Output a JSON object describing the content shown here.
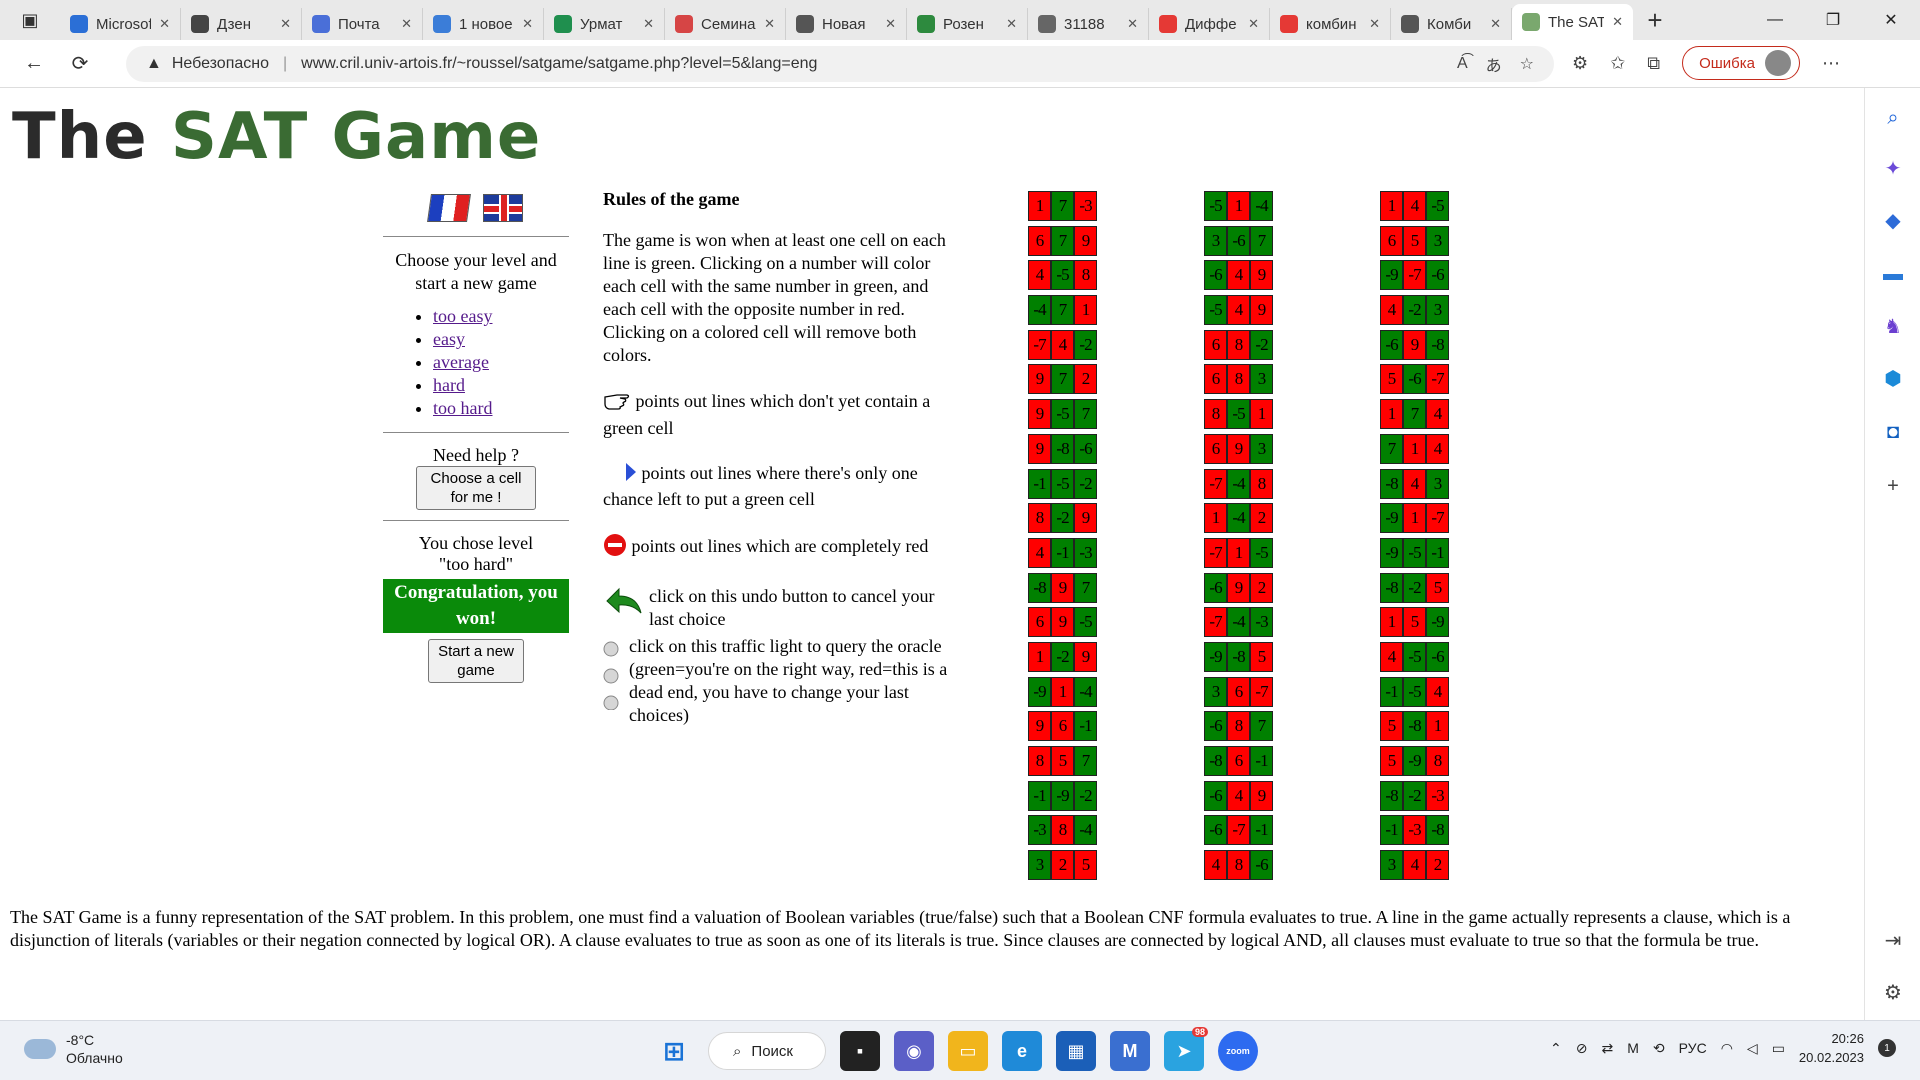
{
  "browser": {
    "tabs": [
      {
        "title": "Microsoft",
        "color": "#2b6fd6"
      },
      {
        "title": "Дзен",
        "color": "#444444"
      },
      {
        "title": "Почта",
        "color": "#4a6fd8"
      },
      {
        "title": "1 новое",
        "color": "#3b7dd8"
      },
      {
        "title": "Урмат",
        "color": "#1f8f4e"
      },
      {
        "title": "Семинар",
        "color": "#d64545"
      },
      {
        "title": "Новая",
        "color": "#555555"
      },
      {
        "title": "Розен",
        "color": "#2d8a3e"
      },
      {
        "title": "31188",
        "color": "#666666"
      },
      {
        "title": "Диффе",
        "color": "#e53935"
      },
      {
        "title": "комбин",
        "color": "#e53935"
      },
      {
        "title": "Комби",
        "color": "#555555"
      },
      {
        "title": "The SAT",
        "color": "#7aa86e",
        "active": true
      }
    ],
    "security_label": "Небезопасно",
    "url": "www.cril.univ-artois.fr/~roussel/satgame/satgame.php?level=5&lang=eng",
    "error_label": "Ошибка"
  },
  "page": {
    "logo_word1": "The",
    "logo_word2": "SAT",
    "logo_word3": "Game",
    "choose_level": "Choose your level and start a new game",
    "levels": [
      "too easy",
      "easy",
      "average",
      "hard",
      "too hard"
    ],
    "need_help": "Need help ?",
    "choose_cell_button": "Choose a cell for me !",
    "you_chose": "You chose level",
    "chosen_level": "\"too hard\"",
    "congrats": "Congratulation, you won!",
    "new_game_button": "Start a new game",
    "rules_title": "Rules of the game",
    "rules_text": "The game is won when at least one cell on each line is green. Clicking on a number will color each cell with the same number in green, and each cell with the opposite number in red. Clicking on a colored cell will remove both colors.",
    "rule_hand": "points out lines which don't yet contain a green cell",
    "rule_arrow": "points out lines where there's only one chance left to put a green cell",
    "rule_stop": "points out lines which are completely red",
    "rule_undo": "click on this undo button to cancel your last choice",
    "rule_oracle": "click on this traffic light to query the oracle (green=you're on the right way, red=this is a dead end, you have to change your last choices)",
    "about": "The SAT Game is a funny representation of the SAT problem. In this problem, one must find a valuation of Boolean variables (true/false) such that a Boolean CNF formula evaluates to true. A line in the game actually represents a clause, which is a disjunction of literals (variables or their negation connected by logical OR). A clause evaluates to true as soon as one of its literals is true. Since clauses are connected by logical AND, all clauses must evaluate to true so that the formula be true."
  },
  "clauses": [
    [
      [
        [
          "1",
          "r"
        ],
        [
          "7",
          "g"
        ],
        [
          "-3",
          "r"
        ]
      ],
      [
        [
          "6",
          "r"
        ],
        [
          "7",
          "g"
        ],
        [
          "9",
          "r"
        ]
      ],
      [
        [
          "4",
          "r"
        ],
        [
          "-5",
          "g"
        ],
        [
          "8",
          "r"
        ]
      ],
      [
        [
          "-4",
          "g"
        ],
        [
          "7",
          "g"
        ],
        [
          "1",
          "r"
        ]
      ],
      [
        [
          "-7",
          "r"
        ],
        [
          "4",
          "r"
        ],
        [
          "-2",
          "g"
        ]
      ],
      [
        [
          "9",
          "r"
        ],
        [
          "7",
          "g"
        ],
        [
          "2",
          "r"
        ]
      ],
      [
        [
          "9",
          "r"
        ],
        [
          "-5",
          "g"
        ],
        [
          "7",
          "g"
        ]
      ],
      [
        [
          "9",
          "r"
        ],
        [
          "-8",
          "g"
        ],
        [
          "-6",
          "g"
        ]
      ],
      [
        [
          "-1",
          "g"
        ],
        [
          "-5",
          "g"
        ],
        [
          "-2",
          "g"
        ]
      ],
      [
        [
          "8",
          "r"
        ],
        [
          "-2",
          "g"
        ],
        [
          "9",
          "r"
        ]
      ],
      [
        [
          "4",
          "r"
        ],
        [
          "-1",
          "g"
        ],
        [
          "-3",
          "g"
        ]
      ],
      [
        [
          "-8",
          "g"
        ],
        [
          "9",
          "r"
        ],
        [
          "7",
          "g"
        ]
      ],
      [
        [
          "6",
          "r"
        ],
        [
          "9",
          "r"
        ],
        [
          "-5",
          "g"
        ]
      ],
      [
        [
          "1",
          "r"
        ],
        [
          "-2",
          "g"
        ],
        [
          "9",
          "r"
        ]
      ],
      [
        [
          "-9",
          "g"
        ],
        [
          "1",
          "r"
        ],
        [
          "-4",
          "g"
        ]
      ],
      [
        [
          "9",
          "r"
        ],
        [
          "6",
          "r"
        ],
        [
          "-1",
          "g"
        ]
      ],
      [
        [
          "8",
          "r"
        ],
        [
          "5",
          "r"
        ],
        [
          "7",
          "g"
        ]
      ],
      [
        [
          "-1",
          "g"
        ],
        [
          "-9",
          "g"
        ],
        [
          "-2",
          "g"
        ]
      ],
      [
        [
          "-3",
          "g"
        ],
        [
          "8",
          "r"
        ],
        [
          "-4",
          "g"
        ]
      ],
      [
        [
          "3",
          "g"
        ],
        [
          "2",
          "r"
        ],
        [
          "5",
          "r"
        ]
      ]
    ],
    [
      [
        [
          "-5",
          "g"
        ],
        [
          "1",
          "r"
        ],
        [
          "-4",
          "g"
        ]
      ],
      [
        [
          "3",
          "g"
        ],
        [
          "-6",
          "g"
        ],
        [
          "7",
          "g"
        ]
      ],
      [
        [
          "-6",
          "g"
        ],
        [
          "4",
          "r"
        ],
        [
          "9",
          "r"
        ]
      ],
      [
        [
          "-5",
          "g"
        ],
        [
          "4",
          "r"
        ],
        [
          "9",
          "r"
        ]
      ],
      [
        [
          "6",
          "r"
        ],
        [
          "8",
          "r"
        ],
        [
          "-2",
          "g"
        ]
      ],
      [
        [
          "6",
          "r"
        ],
        [
          "8",
          "r"
        ],
        [
          "3",
          "g"
        ]
      ],
      [
        [
          "8",
          "r"
        ],
        [
          "-5",
          "g"
        ],
        [
          "1",
          "r"
        ]
      ],
      [
        [
          "6",
          "r"
        ],
        [
          "9",
          "r"
        ],
        [
          "3",
          "g"
        ]
      ],
      [
        [
          "-7",
          "r"
        ],
        [
          "-4",
          "g"
        ],
        [
          "8",
          "r"
        ]
      ],
      [
        [
          "1",
          "r"
        ],
        [
          "-4",
          "g"
        ],
        [
          "2",
          "r"
        ]
      ],
      [
        [
          "-7",
          "r"
        ],
        [
          "1",
          "r"
        ],
        [
          "-5",
          "g"
        ]
      ],
      [
        [
          "-6",
          "g"
        ],
        [
          "9",
          "r"
        ],
        [
          "2",
          "r"
        ]
      ],
      [
        [
          "-7",
          "r"
        ],
        [
          "-4",
          "g"
        ],
        [
          "-3",
          "g"
        ]
      ],
      [
        [
          "-9",
          "g"
        ],
        [
          "-8",
          "g"
        ],
        [
          "5",
          "r"
        ]
      ],
      [
        [
          "3",
          "g"
        ],
        [
          "6",
          "r"
        ],
        [
          "-7",
          "r"
        ]
      ],
      [
        [
          "-6",
          "g"
        ],
        [
          "8",
          "r"
        ],
        [
          "7",
          "g"
        ]
      ],
      [
        [
          "-8",
          "g"
        ],
        [
          "6",
          "r"
        ],
        [
          "-1",
          "g"
        ]
      ],
      [
        [
          "-6",
          "g"
        ],
        [
          "4",
          "r"
        ],
        [
          "9",
          "r"
        ]
      ],
      [
        [
          "-6",
          "g"
        ],
        [
          "-7",
          "r"
        ],
        [
          "-1",
          "g"
        ]
      ],
      [
        [
          "4",
          "r"
        ],
        [
          "8",
          "r"
        ],
        [
          "-6",
          "g"
        ]
      ]
    ],
    [
      [
        [
          "1",
          "r"
        ],
        [
          "4",
          "r"
        ],
        [
          "-5",
          "g"
        ]
      ],
      [
        [
          "6",
          "r"
        ],
        [
          "5",
          "r"
        ],
        [
          "3",
          "g"
        ]
      ],
      [
        [
          "-9",
          "g"
        ],
        [
          "-7",
          "r"
        ],
        [
          "-6",
          "g"
        ]
      ],
      [
        [
          "4",
          "r"
        ],
        [
          "-2",
          "g"
        ],
        [
          "3",
          "g"
        ]
      ],
      [
        [
          "-6",
          "g"
        ],
        [
          "9",
          "r"
        ],
        [
          "-8",
          "g"
        ]
      ],
      [
        [
          "5",
          "r"
        ],
        [
          "-6",
          "g"
        ],
        [
          "-7",
          "r"
        ]
      ],
      [
        [
          "1",
          "r"
        ],
        [
          "7",
          "g"
        ],
        [
          "4",
          "r"
        ]
      ],
      [
        [
          "7",
          "g"
        ],
        [
          "1",
          "r"
        ],
        [
          "4",
          "r"
        ]
      ],
      [
        [
          "-8",
          "g"
        ],
        [
          "4",
          "r"
        ],
        [
          "3",
          "g"
        ]
      ],
      [
        [
          "-9",
          "g"
        ],
        [
          "1",
          "r"
        ],
        [
          "-7",
          "r"
        ]
      ],
      [
        [
          "-9",
          "g"
        ],
        [
          "-5",
          "g"
        ],
        [
          "-1",
          "g"
        ]
      ],
      [
        [
          "-8",
          "g"
        ],
        [
          "-2",
          "g"
        ],
        [
          "5",
          "r"
        ]
      ],
      [
        [
          "1",
          "r"
        ],
        [
          "5",
          "r"
        ],
        [
          "-9",
          "g"
        ]
      ],
      [
        [
          "4",
          "r"
        ],
        [
          "-5",
          "g"
        ],
        [
          "-6",
          "g"
        ]
      ],
      [
        [
          "-1",
          "g"
        ],
        [
          "-5",
          "g"
        ],
        [
          "4",
          "r"
        ]
      ],
      [
        [
          "5",
          "r"
        ],
        [
          "-8",
          "g"
        ],
        [
          "1",
          "r"
        ]
      ],
      [
        [
          "5",
          "r"
        ],
        [
          "-9",
          "g"
        ],
        [
          "8",
          "r"
        ]
      ],
      [
        [
          "-8",
          "g"
        ],
        [
          "-2",
          "g"
        ],
        [
          "-3",
          "r"
        ]
      ],
      [
        [
          "-1",
          "g"
        ],
        [
          "-3",
          "r"
        ],
        [
          "-8",
          "g"
        ]
      ],
      [
        [
          "3",
          "g"
        ],
        [
          "4",
          "r"
        ],
        [
          "2",
          "r"
        ]
      ]
    ]
  ],
  "taskbar": {
    "temperature": "-8°C",
    "weather": "Облачно",
    "search_label": "Поиск",
    "telegram_badge": "98",
    "lang": "РУС",
    "time": "20:26",
    "date": "20.02.2023",
    "notif_count": "1"
  }
}
